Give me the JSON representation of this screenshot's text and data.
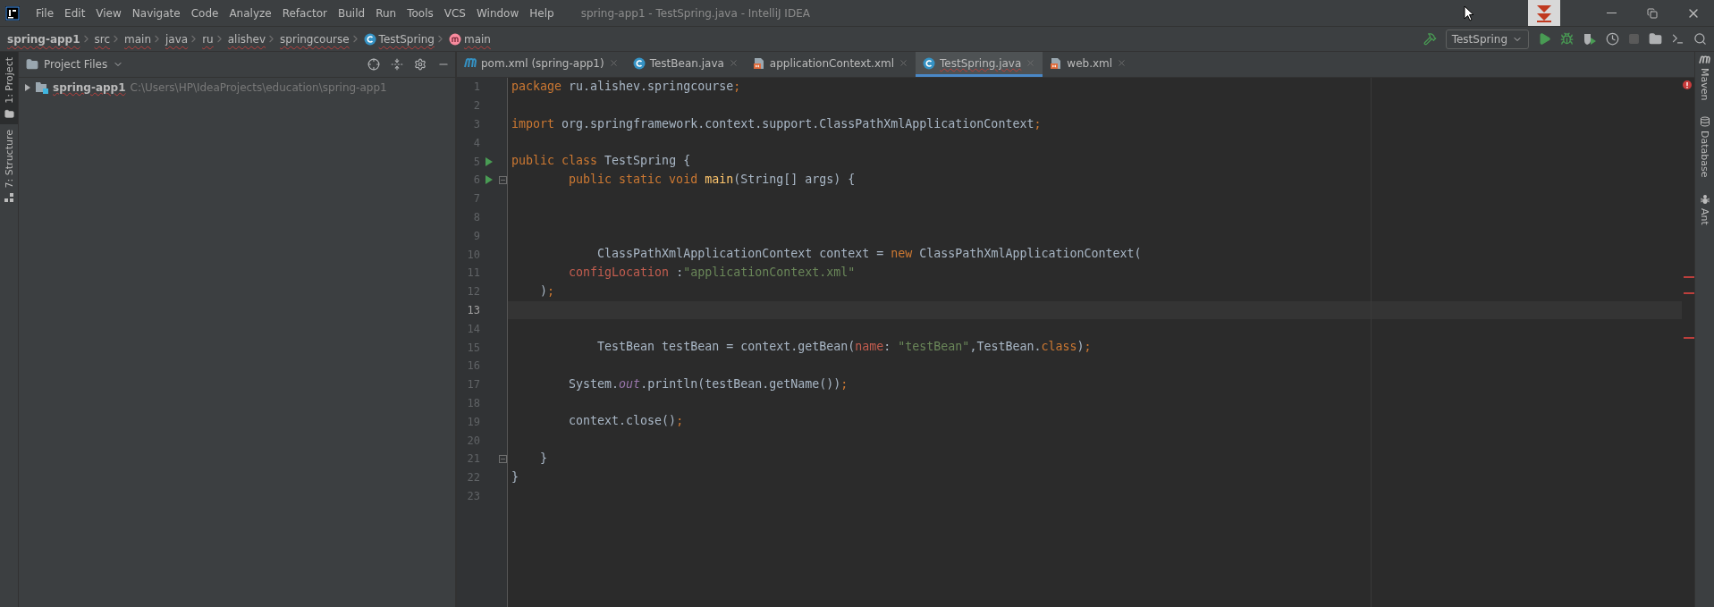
{
  "window": {
    "title": "spring-app1 - TestSpring.java - IntelliJ IDEA"
  },
  "menu": [
    "File",
    "Edit",
    "View",
    "Navigate",
    "Code",
    "Analyze",
    "Refactor",
    "Build",
    "Run",
    "Tools",
    "VCS",
    "Window",
    "Help"
  ],
  "breadcrumbs": [
    {
      "label": "spring-app1",
      "kind": "project"
    },
    {
      "label": "src",
      "kind": "folder"
    },
    {
      "label": "main",
      "kind": "folder"
    },
    {
      "label": "java",
      "kind": "folder"
    },
    {
      "label": "ru",
      "kind": "folder"
    },
    {
      "label": "alishev",
      "kind": "folder"
    },
    {
      "label": "springcourse",
      "kind": "folder"
    },
    {
      "label": "TestSpring",
      "kind": "class"
    },
    {
      "label": "main",
      "kind": "method"
    }
  ],
  "run_config": {
    "label": "TestSpring"
  },
  "left_tool_windows": [
    {
      "label": "1: Project",
      "selected": true
    },
    {
      "label": "7: Structure",
      "selected": false
    }
  ],
  "right_tool_windows": [
    {
      "label": "Maven",
      "kind": "maven"
    },
    {
      "label": "Database",
      "kind": "database"
    },
    {
      "label": "Ant",
      "kind": "ant"
    }
  ],
  "project_panel": {
    "title": "Project Files",
    "tree": [
      {
        "name": "spring-app1",
        "path": "C:\\Users\\HP\\IdeaProjects\\education\\spring-app1",
        "expanded": false
      }
    ]
  },
  "tabs": [
    {
      "label": "pom.xml (spring-app1)",
      "kind": "maven",
      "selected": false
    },
    {
      "label": "TestBean.java",
      "kind": "class",
      "selected": false
    },
    {
      "label": "applicationContext.xml",
      "kind": "xml",
      "selected": false
    },
    {
      "label": "TestSpring.java",
      "kind": "class",
      "selected": true
    },
    {
      "label": "web.xml",
      "kind": "xml",
      "selected": false
    }
  ],
  "code": [
    {
      "number": "1",
      "run": false,
      "fold": false,
      "current": false,
      "tokens": [
        {
          "t": "package ",
          "kind": "keyword"
        },
        {
          "t": "ru.alishev.springcourse",
          "kind": "plain"
        },
        {
          "t": ";",
          "kind": "keyword"
        }
      ]
    },
    {
      "number": "2",
      "run": false,
      "fold": false,
      "current": false
    },
    {
      "number": "3",
      "run": false,
      "fold": false,
      "current": false,
      "tokens": [
        {
          "t": "import ",
          "kind": "keyword"
        },
        {
          "t": "org.springframework.context.support.ClassPathXmlApplicationContext",
          "kind": "plain"
        },
        {
          "t": ";",
          "kind": "keyword"
        }
      ]
    },
    {
      "number": "4",
      "run": false,
      "fold": false,
      "current": false
    },
    {
      "number": "5",
      "run": true,
      "fold": false,
      "current": false,
      "tokens": [
        {
          "t": "public class ",
          "kind": "keyword"
        },
        {
          "t": "TestSpring {",
          "kind": "plain"
        }
      ]
    },
    {
      "number": "6",
      "run": true,
      "fold": true,
      "current": false,
      "tokens": [
        {
          "t": "        public static void ",
          "kind": "keyword"
        },
        {
          "t": "main",
          "kind": "method"
        },
        {
          "t": "(String[] args) {",
          "kind": "plain"
        }
      ]
    },
    {
      "number": "7",
      "run": false,
      "fold": false,
      "current": false
    },
    {
      "number": "8",
      "run": false,
      "fold": false,
      "current": false
    },
    {
      "number": "9",
      "run": false,
      "fold": false,
      "current": false
    },
    {
      "number": "10",
      "run": false,
      "fold": false,
      "current": false,
      "tokens": [
        {
          "t": "            ClassPathXmlApplicationContext context = ",
          "kind": "plain"
        },
        {
          "t": "new ",
          "kind": "keyword"
        },
        {
          "t": "ClassPathXmlApplicationContext(",
          "kind": "plain"
        }
      ]
    },
    {
      "number": "11",
      "run": false,
      "fold": false,
      "current": false,
      "tokens": [
        {
          "t": "        configLocation",
          "kind": "param"
        },
        {
          "t": " :",
          "kind": "plain"
        },
        {
          "t": "\"applicationContext.xml\"",
          "kind": "string"
        }
      ]
    },
    {
      "number": "12",
      "run": false,
      "fold": false,
      "current": false,
      "tokens": [
        {
          "t": "    )",
          "kind": "plain"
        },
        {
          "t": ";",
          "kind": "keyword"
        }
      ]
    },
    {
      "number": "13",
      "run": false,
      "fold": false,
      "current": true
    },
    {
      "number": "14",
      "run": false,
      "fold": false,
      "current": false
    },
    {
      "number": "15",
      "run": false,
      "fold": false,
      "current": false,
      "tokens": [
        {
          "t": "            TestBean testBean = context.getBean(",
          "kind": "plain"
        },
        {
          "t": "name",
          "kind": "param"
        },
        {
          "t": ": ",
          "kind": "plain"
        },
        {
          "t": "\"testBean\"",
          "kind": "string"
        },
        {
          "t": ",TestBean.",
          "kind": "plain"
        },
        {
          "t": "class",
          "kind": "keyword"
        },
        {
          "t": ")",
          "kind": "plain"
        },
        {
          "t": ";",
          "kind": "keyword"
        }
      ]
    },
    {
      "number": "16",
      "run": false,
      "fold": false,
      "current": false
    },
    {
      "number": "17",
      "run": false,
      "fold": false,
      "current": false,
      "tokens": [
        {
          "t": "        System.",
          "kind": "plain"
        },
        {
          "t": "out",
          "kind": "field"
        },
        {
          "t": ".println(testBean.getName())",
          "kind": "plain"
        },
        {
          "t": ";",
          "kind": "keyword"
        }
      ]
    },
    {
      "number": "18",
      "run": false,
      "fold": false,
      "current": false
    },
    {
      "number": "19",
      "run": false,
      "fold": false,
      "current": false,
      "tokens": [
        {
          "t": "        context.close()",
          "kind": "plain"
        },
        {
          "t": ";",
          "kind": "keyword"
        }
      ]
    },
    {
      "number": "20",
      "run": false,
      "fold": false,
      "current": false
    },
    {
      "number": "21",
      "run": false,
      "fold": true,
      "current": false,
      "tokens": [
        {
          "t": "    }",
          "kind": "plain"
        }
      ]
    },
    {
      "number": "22",
      "run": false,
      "fold": false,
      "current": false,
      "tokens": [
        {
          "t": "}",
          "kind": "plain"
        }
      ]
    },
    {
      "number": "23",
      "run": false,
      "fold": false,
      "current": false
    }
  ]
}
